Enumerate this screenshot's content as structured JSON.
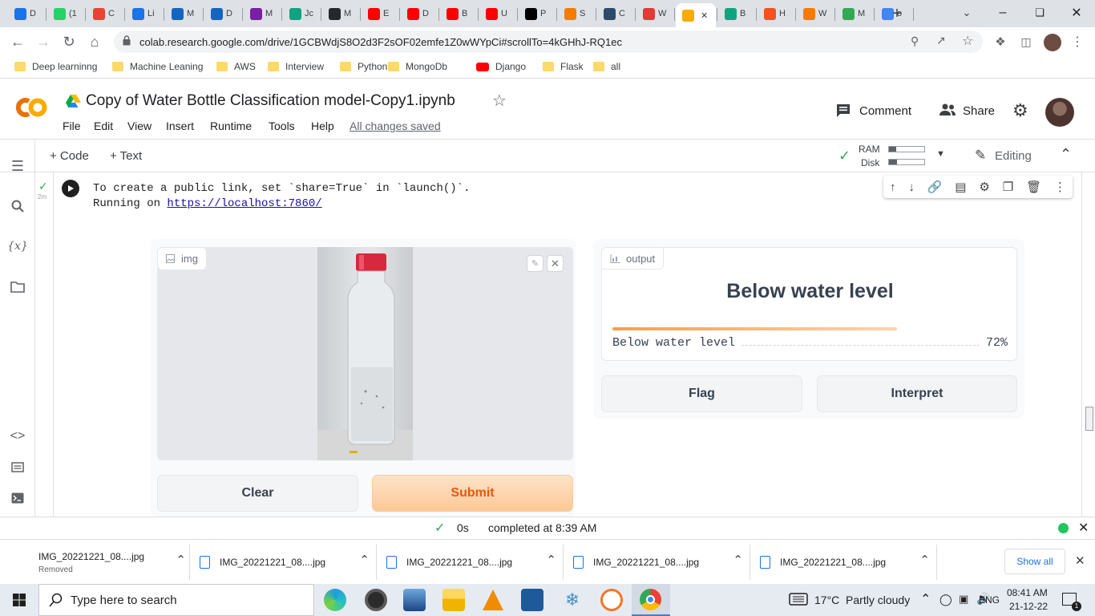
{
  "browser": {
    "tabs": [
      {
        "label": "D",
        "icon": "download-icon",
        "color": "#1a73e8"
      },
      {
        "label": "(1",
        "icon": "whatsapp-icon",
        "color": "#25d366"
      },
      {
        "label": "C",
        "icon": "gmail-icon",
        "color": "#ea4335"
      },
      {
        "label": "Li",
        "icon": "is-icon",
        "color": "#1a73e8"
      },
      {
        "label": "M",
        "icon": "k-icon",
        "color": "#1565c0"
      },
      {
        "label": "D",
        "icon": "k-icon",
        "color": "#1565c0"
      },
      {
        "label": "M",
        "icon": "pen-icon",
        "color": "#7b1fa2"
      },
      {
        "label": "Jc",
        "icon": "chatgpt-icon",
        "color": "#10a37f"
      },
      {
        "label": "M",
        "icon": "github-icon",
        "color": "#24292e"
      },
      {
        "label": "E",
        "icon": "youtube-icon",
        "color": "#ff0000"
      },
      {
        "label": "D",
        "icon": "youtube-icon",
        "color": "#ff0000"
      },
      {
        "label": "B",
        "icon": "youtube-icon",
        "color": "#ff0000"
      },
      {
        "label": "U",
        "icon": "youtube-icon",
        "color": "#ff0000"
      },
      {
        "label": "P",
        "icon": "medium-icon",
        "color": "#000000"
      },
      {
        "label": "S",
        "icon": "c-icon",
        "color": "#f57c00"
      },
      {
        "label": "C",
        "icon": "h-icon",
        "color": "#2e4a6b"
      },
      {
        "label": "W",
        "icon": "co-icon",
        "color": "#e53935"
      },
      {
        "label": "",
        "icon": "colab-icon",
        "color": "#f9ab00",
        "active": true
      },
      {
        "label": "B",
        "icon": "chatgpt-icon",
        "color": "#10a37f"
      },
      {
        "label": "H",
        "icon": "arc-icon",
        "color": "#f4511e"
      },
      {
        "label": "W",
        "icon": "book-icon",
        "color": "#f57c00"
      },
      {
        "label": "M",
        "icon": "drive-icon",
        "color": "#34a853"
      },
      {
        "label": "o",
        "icon": "google-icon",
        "color": "#4285f4"
      }
    ],
    "url": "colab.research.google.com/drive/1GCBWdjS8O2d3F2sOF02emfe1Z0wWYpCi#scrollTo=4kGHhJ-RQ1ec",
    "bookmarks": [
      "Deep learninng",
      "Machine Leaning",
      "AWS",
      "Interview",
      "Python",
      "MongoDb",
      "Django",
      "Flask",
      "all"
    ]
  },
  "colab": {
    "logo": "CO",
    "title": "Copy of Water Bottle Classification model-Copy1.ipynb",
    "menu": [
      "File",
      "Edit",
      "View",
      "Insert",
      "Runtime",
      "Tools",
      "Help"
    ],
    "saved_status": "All changes saved",
    "comment_label": "Comment",
    "share_label": "Share",
    "add_code": "+ Code",
    "add_text": "+ Text",
    "ram_label": "RAM",
    "disk_label": "Disk",
    "editing_label": "Editing",
    "cell_exec_time": "2m",
    "output_line1": "To create a public link, set `share=True` in `launch()`.",
    "output_line2_prefix": "Running on ",
    "output_link": "https://localhost:7860/"
  },
  "gradio": {
    "input_label": "img",
    "output_label": "output",
    "prediction": "Below water level",
    "confidence_label": "Below water level",
    "confidence_value": "72%",
    "confidence_fraction": 0.72,
    "clear_label": "Clear",
    "submit_label": "Submit",
    "flag_label": "Flag",
    "interpret_label": "Interpret"
  },
  "status": {
    "time": "0s",
    "message": "completed at 8:39 AM"
  },
  "downloads": {
    "items": [
      {
        "name": "IMG_20221221_08....jpg",
        "sub": "Removed"
      },
      {
        "name": "IMG_20221221_08....jpg",
        "sub": ""
      },
      {
        "name": "IMG_20221221_08....jpg",
        "sub": ""
      },
      {
        "name": "IMG_20221221_08....jpg",
        "sub": ""
      },
      {
        "name": "IMG_20221221_08....jpg",
        "sub": ""
      }
    ],
    "show_all": "Show all"
  },
  "taskbar": {
    "search_placeholder": "Type here to search",
    "weather": "17°C  Partly cloudy",
    "lang": "ENG",
    "time": "08:41 AM",
    "date": "21-12-22"
  }
}
